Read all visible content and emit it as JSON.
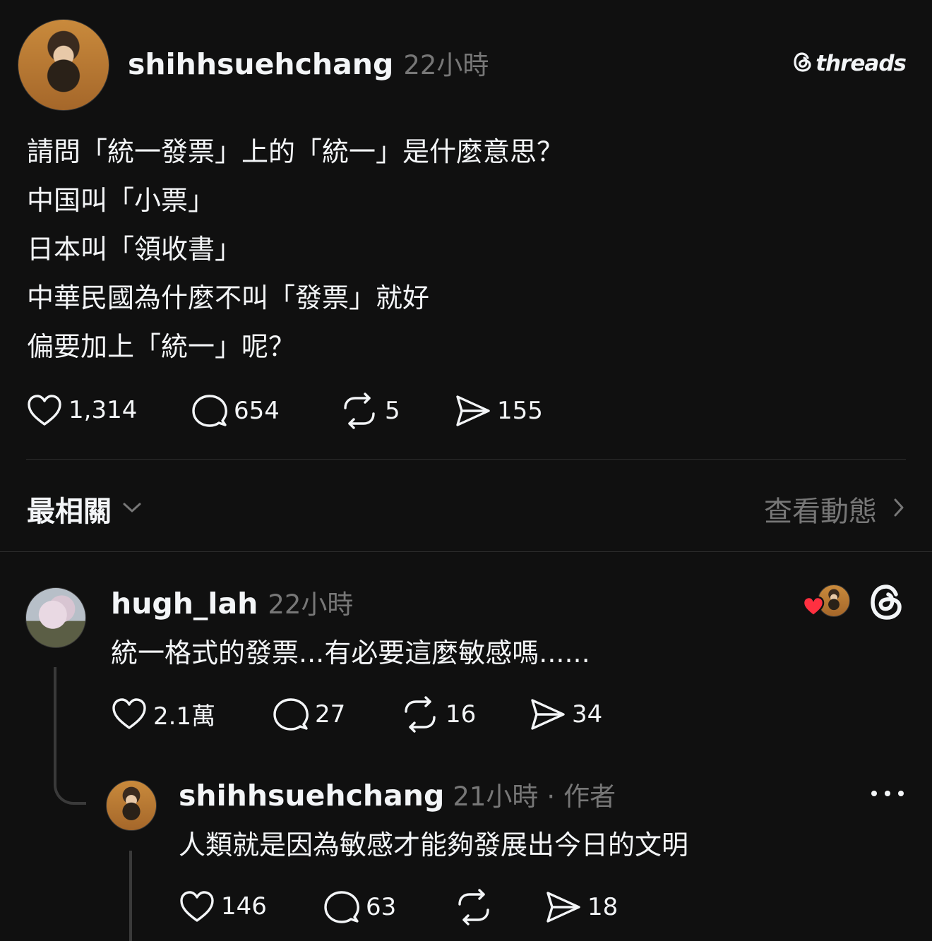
{
  "brand": {
    "logo_text": "threads"
  },
  "post": {
    "username": "shihhsuehchang",
    "time": "22小時",
    "lines": [
      "請問「統一發票」上的「統一」是什麼意思？",
      "中国叫「小票」",
      "日本叫「領收書」",
      "中華民國為什麼不叫「發票」就好",
      "偏要加上「統一」呢？"
    ],
    "likes": "1,314",
    "comments": "654",
    "reposts": "5",
    "shares": "155"
  },
  "sort_bar": {
    "label": "最相關",
    "view_activity": "查看動態"
  },
  "reply1": {
    "username": "hugh_lah",
    "time": "22小時",
    "text": "統一格式的發票...有必要這麼敏感嗎......",
    "likes": "2.1萬",
    "comments": "27",
    "reposts": "16",
    "shares": "34"
  },
  "reply2": {
    "username": "shihhsuehchang",
    "time": "21小時",
    "separator": "·",
    "author_tag": "作者",
    "text": "人類就是因為敏感才能夠發展出今日的文明",
    "likes": "146",
    "comments": "63",
    "shares": "18"
  },
  "colors": {
    "background": "#101010",
    "text": "#f3f5f7",
    "muted": "#777777",
    "like_red": "#ff3040"
  }
}
